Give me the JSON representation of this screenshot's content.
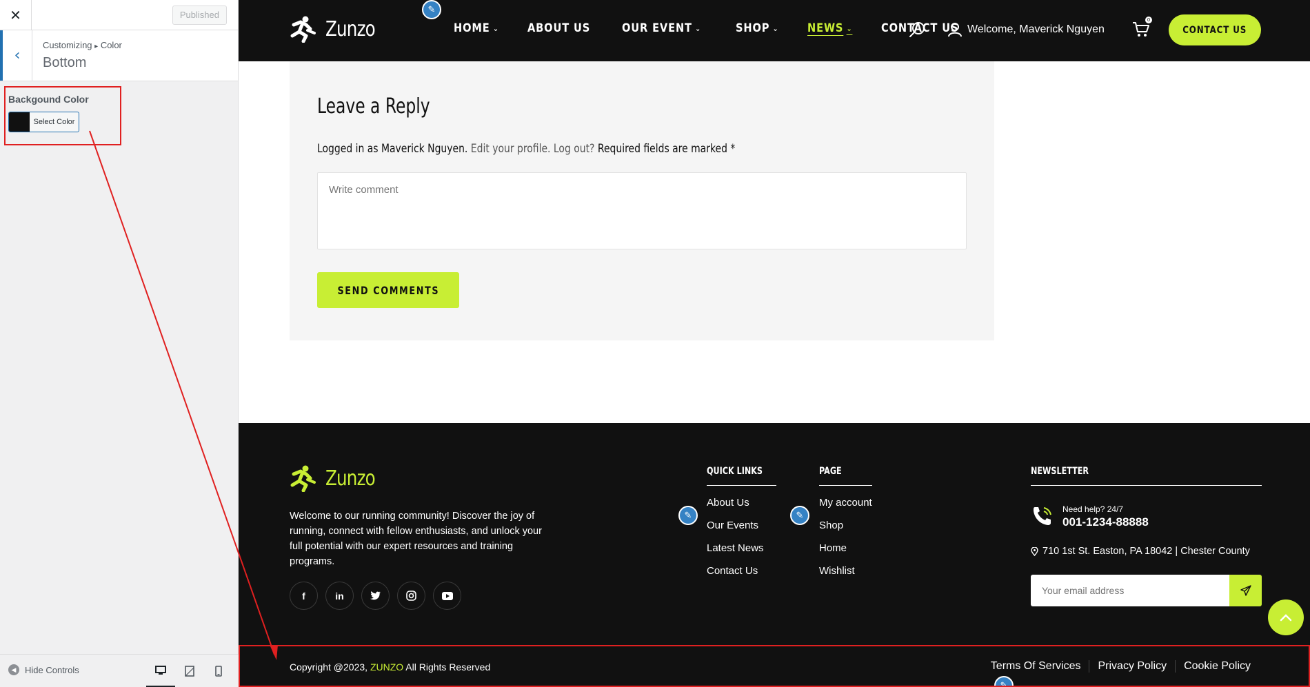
{
  "customizer": {
    "close_icon": "close-icon",
    "published_label": "Published",
    "breadcrumb_part1": "Customizing",
    "breadcrumb_sep": "▸",
    "breadcrumb_part2": "Color",
    "section_title": "Bottom",
    "control_label": "Backgound Color",
    "color_button_label": "Select Color",
    "swatch_color": "#111111",
    "hide_controls_label": "Hide Controls",
    "devices": [
      "desktop-icon",
      "tablet-icon",
      "mobile-icon"
    ]
  },
  "header": {
    "logo_text": "Zunzo",
    "nav": [
      {
        "label": "HOME",
        "has_dropdown": true
      },
      {
        "label": "ABOUT US",
        "has_dropdown": false
      },
      {
        "label": "OUR EVENT",
        "has_dropdown": true
      },
      {
        "label": "SHOP",
        "has_dropdown": true
      },
      {
        "label": "NEWS",
        "has_dropdown": true,
        "active": true
      },
      {
        "label": "CONTACT US",
        "has_dropdown": false
      }
    ],
    "welcome_text": "Welcome, Maverick Nguyen",
    "cart_count": "0",
    "contact_button": "CONTACT US"
  },
  "reply": {
    "title": "Leave a Reply",
    "logged_in_prefix": "Logged in as Maverick Nguyen.",
    "edit_profile_link": "Edit your profile.",
    "logout_link": "Log out?",
    "required_text": "Required fields are marked *",
    "comment_placeholder": "Write comment",
    "send_button": "SEND COMMENTS"
  },
  "footer": {
    "logo_text": "Zunzo",
    "about": "Welcome to our running community! Discover the joy of running, connect with fellow enthusiasts, and unlock your full potential with our expert resources and training programs.",
    "socials": [
      "facebook-icon",
      "linkedin-icon",
      "twitter-icon",
      "instagram-icon",
      "youtube-icon"
    ],
    "quick_links_title": "QUICK LINKS",
    "quick_links": [
      "About Us",
      "Our Events",
      "Latest News",
      "Contact Us"
    ],
    "page_title": "PAGE",
    "page_links": [
      "My account",
      "Shop",
      "Home",
      "Wishlist"
    ],
    "newsletter_title": "NEWSLETTER",
    "help_label": "Need help? 24/7",
    "help_phone": "001-1234-88888",
    "address": "710 1st St. Easton, PA 18042 | Chester County",
    "email_placeholder": "Your email address",
    "copyright_prefix": "Copyright @2023,",
    "copyright_brand": "ZUNZO",
    "copyright_suffix": "All Rights Reserved",
    "legal_links": [
      "Terms Of Services",
      "Privacy Policy",
      "Cookie Policy"
    ]
  },
  "colors": {
    "accent": "#c8ee34",
    "dark": "#111111",
    "wp_blue": "#2271b1",
    "annotation_red": "#e02020"
  }
}
